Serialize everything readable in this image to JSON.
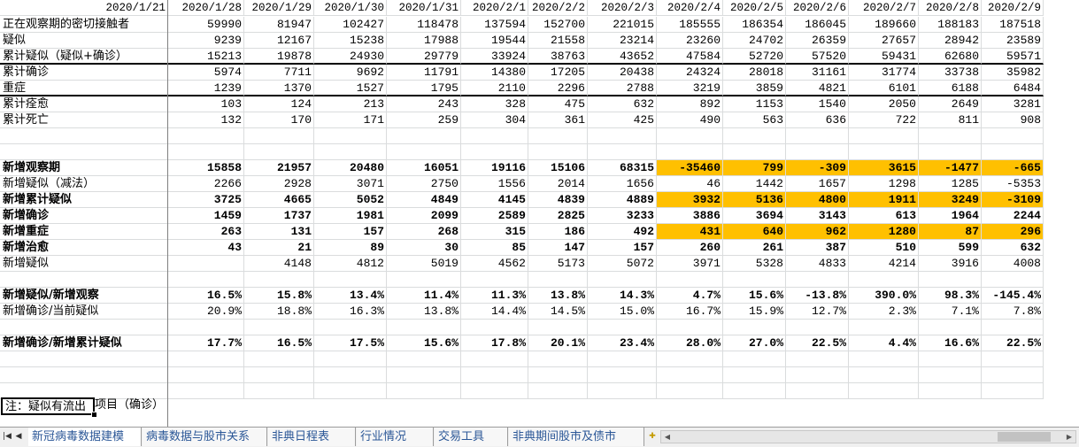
{
  "columns": [
    "2020/1/21",
    "2020/1/28",
    "2020/1/29",
    "2020/1/30",
    "2020/1/31",
    "2020/2/1",
    "2020/2/2",
    "2020/2/3",
    "2020/2/4",
    "2020/2/5",
    "2020/2/6",
    "2020/2/7",
    "2020/2/8",
    "2020/2/9"
  ],
  "rows": [
    {
      "label": "正在观察期的密切接触者",
      "bold": false,
      "values": [
        "59990",
        "81947",
        "102427",
        "118478",
        "137594",
        "152700",
        "221015",
        "185555",
        "186354",
        "186045",
        "189660",
        "188183",
        "187518"
      ]
    },
    {
      "label": "疑似",
      "bold": false,
      "values": [
        "9239",
        "12167",
        "15238",
        "17988",
        "19544",
        "21558",
        "23214",
        "23260",
        "24702",
        "26359",
        "27657",
        "28942",
        "23589"
      ]
    },
    {
      "label": "累计疑似（疑似+确诊）",
      "bold": false,
      "values": [
        "15213",
        "19878",
        "24930",
        "29779",
        "33924",
        "38763",
        "43652",
        "47584",
        "52720",
        "57520",
        "59431",
        "62680",
        "59571"
      ]
    },
    {
      "label": "累计确诊",
      "bold": false,
      "values": [
        "5974",
        "7711",
        "9692",
        "11791",
        "14380",
        "17205",
        "20438",
        "24324",
        "28018",
        "31161",
        "31774",
        "33738",
        "35982"
      ]
    },
    {
      "label": "重症",
      "bold": false,
      "values": [
        "1239",
        "1370",
        "1527",
        "1795",
        "2110",
        "2296",
        "2788",
        "3219",
        "3859",
        "4821",
        "6101",
        "6188",
        "6484"
      ]
    },
    {
      "label": "累计痊愈",
      "bold": false,
      "values": [
        "103",
        "124",
        "213",
        "243",
        "328",
        "475",
        "632",
        "892",
        "1153",
        "1540",
        "2050",
        "2649",
        "3281"
      ]
    },
    {
      "label": "累计死亡",
      "bold": false,
      "values": [
        "132",
        "170",
        "171",
        "259",
        "304",
        "361",
        "425",
        "490",
        "563",
        "636",
        "722",
        "811",
        "908"
      ]
    },
    {
      "label": "",
      "bold": false,
      "values": []
    },
    {
      "label": "",
      "bold": false,
      "values": []
    },
    {
      "label": "新增观察期",
      "bold": true,
      "values": [
        "15858",
        "21957",
        "20480",
        "16051",
        "19116",
        "15106",
        "68315",
        "-35460",
        "799",
        "-309",
        "3615",
        "-1477",
        "-665"
      ],
      "highlight_from": 7
    },
    {
      "label": "新增疑似（减法）",
      "bold": false,
      "values": [
        "2266",
        "2928",
        "3071",
        "2750",
        "1556",
        "2014",
        "1656",
        "46",
        "1442",
        "1657",
        "1298",
        "1285",
        "-5353"
      ]
    },
    {
      "label": "新增累计疑似",
      "bold": true,
      "values": [
        "3725",
        "4665",
        "5052",
        "4849",
        "4145",
        "4839",
        "4889",
        "3932",
        "5136",
        "4800",
        "1911",
        "3249",
        "-3109"
      ],
      "highlight_from": 7
    },
    {
      "label": "新增确诊",
      "bold": true,
      "values": [
        "1459",
        "1737",
        "1981",
        "2099",
        "2589",
        "2825",
        "3233",
        "3886",
        "3694",
        "3143",
        "613",
        "1964",
        "2244"
      ]
    },
    {
      "label": "新增重症",
      "bold": true,
      "values": [
        "263",
        "131",
        "157",
        "268",
        "315",
        "186",
        "492",
        "431",
        "640",
        "962",
        "1280",
        "87",
        "296"
      ],
      "highlight_from": 7
    },
    {
      "label": "新增治愈",
      "bold": true,
      "values": [
        "43",
        "21",
        "89",
        "30",
        "85",
        "147",
        "157",
        "260",
        "261",
        "387",
        "510",
        "599",
        "632"
      ]
    },
    {
      "label": "新增疑似",
      "bold": false,
      "values": [
        "",
        "4148",
        "4812",
        "5019",
        "4562",
        "5173",
        "5072",
        "3971",
        "5328",
        "4833",
        "4214",
        "3916",
        "4008"
      ]
    },
    {
      "label": "",
      "bold": false,
      "values": []
    },
    {
      "label": "新增疑似/新增观察",
      "bold": true,
      "values": [
        "16.5%",
        "15.8%",
        "13.4%",
        "11.4%",
        "11.3%",
        "13.8%",
        "14.3%",
        "4.7%",
        "15.6%",
        "-13.8%",
        "390.0%",
        "98.3%",
        "-145.4%"
      ]
    },
    {
      "label": "新增确诊/当前疑似",
      "bold": false,
      "values": [
        "20.9%",
        "18.8%",
        "16.3%",
        "13.8%",
        "14.4%",
        "14.5%",
        "15.0%",
        "16.7%",
        "15.9%",
        "12.7%",
        "2.3%",
        "7.1%",
        "7.8%"
      ]
    },
    {
      "label": "",
      "bold": false,
      "values": []
    },
    {
      "label": "新增确诊/新增累计疑似",
      "bold": true,
      "values": [
        "17.7%",
        "16.5%",
        "17.5%",
        "15.6%",
        "17.8%",
        "20.1%",
        "23.4%",
        "28.0%",
        "27.0%",
        "22.5%",
        "4.4%",
        "16.6%",
        "22.5%"
      ]
    },
    {
      "label": "",
      "bold": false,
      "values": []
    },
    {
      "label": "",
      "bold": false,
      "values": []
    },
    {
      "label": "",
      "bold": false,
      "values": []
    }
  ],
  "note": {
    "cell_text": "注：疑似有流出",
    "overflow_text": "项目（确诊）"
  },
  "tabs": [
    {
      "label": "新冠病毒数据建模",
      "active": true
    },
    {
      "label": "病毒数据与股市关系",
      "active": false
    },
    {
      "label": "非典日程表",
      "active": false
    },
    {
      "label": "行业情况",
      "active": false
    },
    {
      "label": "交易工具",
      "active": false
    },
    {
      "label": "非典期间股市及债市",
      "active": false
    }
  ],
  "colors": {
    "highlight": "#ffc000",
    "tab_text": "#2b5797"
  }
}
